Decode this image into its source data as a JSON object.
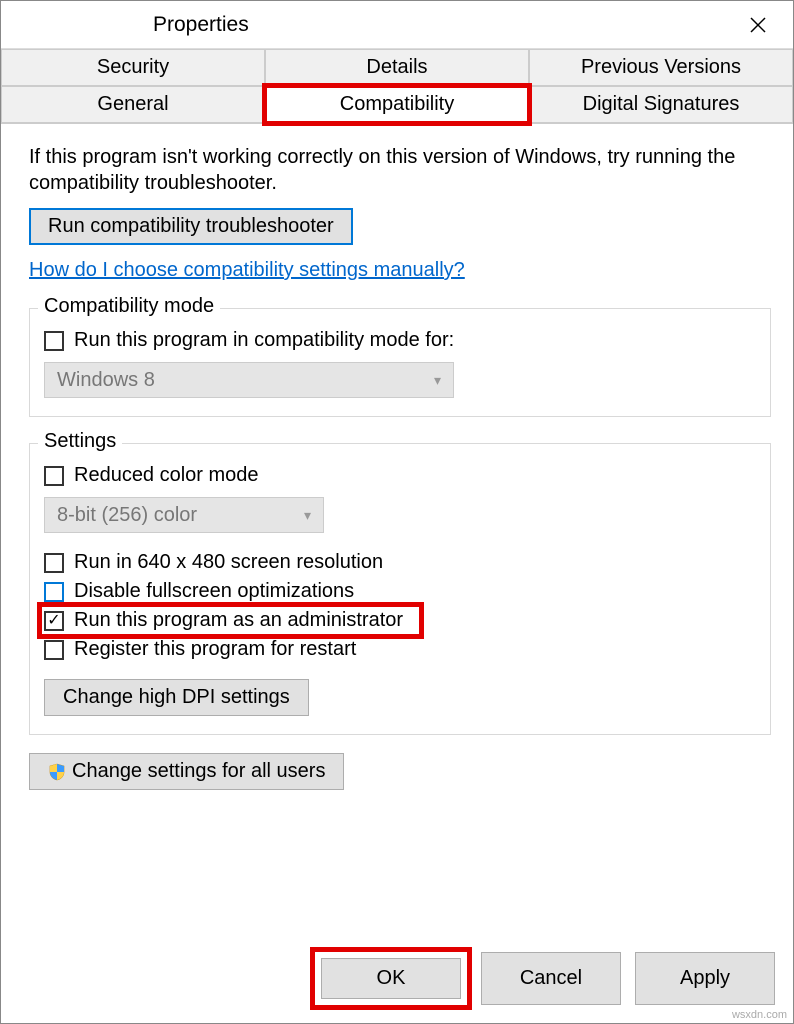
{
  "title": "Properties",
  "tabs": {
    "row1": [
      "Security",
      "Details",
      "Previous Versions"
    ],
    "row2": [
      "General",
      "Compatibility",
      "Digital Signatures"
    ]
  },
  "intro": "If this program isn't working correctly on this version of Windows, try running the compatibility troubleshooter.",
  "troubleshoot_btn": "Run compatibility troubleshooter",
  "help_link": "How do I choose compatibility settings manually?",
  "compat_mode": {
    "legend": "Compatibility mode",
    "check_label": "Run this program in compatibility mode for:",
    "combo_value": "Windows 8"
  },
  "settings": {
    "legend": "Settings",
    "reduced_color": "Reduced color mode",
    "color_combo": "8-bit (256) color",
    "res640": "Run in 640 x 480 screen resolution",
    "fullscreen": "Disable fullscreen optimizations",
    "admin": "Run this program as an administrator",
    "register": "Register this program for restart",
    "dpi_btn": "Change high DPI settings"
  },
  "allusers_btn": "Change settings for all users",
  "footer": {
    "ok": "OK",
    "cancel": "Cancel",
    "apply": "Apply"
  },
  "watermark": "wsxdn.com"
}
